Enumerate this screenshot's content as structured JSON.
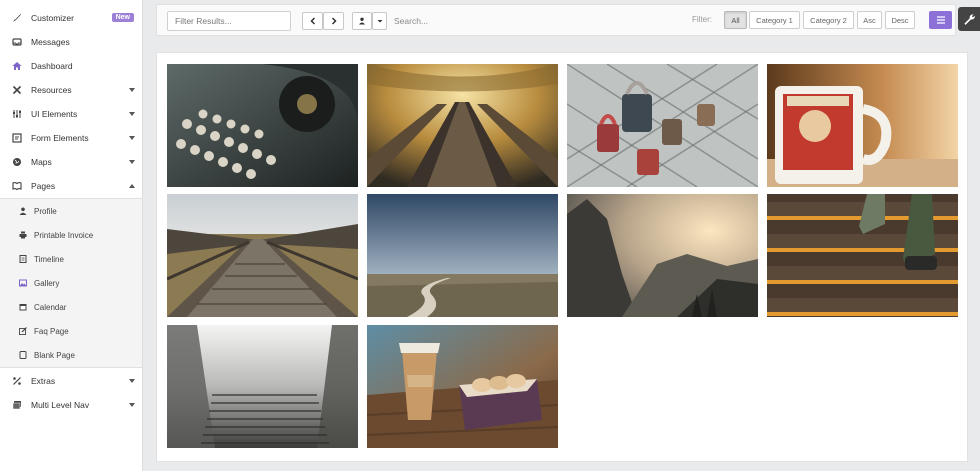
{
  "sidebar": {
    "items": [
      {
        "label": "Customizer",
        "badge": "New",
        "icon": "paintbrush-icon"
      },
      {
        "label": "Messages",
        "icon": "inbox-icon"
      },
      {
        "label": "Dashboard",
        "icon": "home-icon"
      },
      {
        "label": "Resources",
        "icon": "tools-icon"
      },
      {
        "label": "UI Elements",
        "icon": "sliders-icon"
      },
      {
        "label": "Form Elements",
        "icon": "form-icon"
      },
      {
        "label": "Maps",
        "icon": "globe-icon"
      },
      {
        "label": "Pages",
        "icon": "book-icon"
      }
    ],
    "pages_sub": [
      {
        "label": "Profile",
        "icon": "user-icon"
      },
      {
        "label": "Printable Invoice",
        "icon": "print-icon"
      },
      {
        "label": "Timeline",
        "icon": "timeline-icon"
      },
      {
        "label": "Gallery",
        "icon": "image-icon"
      },
      {
        "label": "Calendar",
        "icon": "calendar-icon"
      },
      {
        "label": "Faq Page",
        "icon": "edit-icon"
      },
      {
        "label": "Blank Page",
        "icon": "blank-page-icon"
      }
    ],
    "after": [
      {
        "label": "Extras",
        "icon": "percent-icon"
      },
      {
        "label": "Multi Level Nav",
        "icon": "layers-icon"
      }
    ]
  },
  "toolbar": {
    "filter_placeholder": "Filter Results...",
    "search_placeholder": "Search...",
    "filter_label": "Filter:",
    "chips": [
      "All",
      "Category 1",
      "Category 2",
      "Asc",
      "Desc"
    ]
  },
  "colors": {
    "accent": "#8d6fd8",
    "badge": "#9c7fd6"
  },
  "gallery": {
    "images": [
      "vintage-typewriter",
      "escalator-tunnel",
      "love-locks",
      "red-mug",
      "wooden-boardwalk",
      "country-road",
      "mountain-sunrise",
      "stairs-sneakers",
      "foggy-stairs",
      "coffee-macarons"
    ]
  }
}
